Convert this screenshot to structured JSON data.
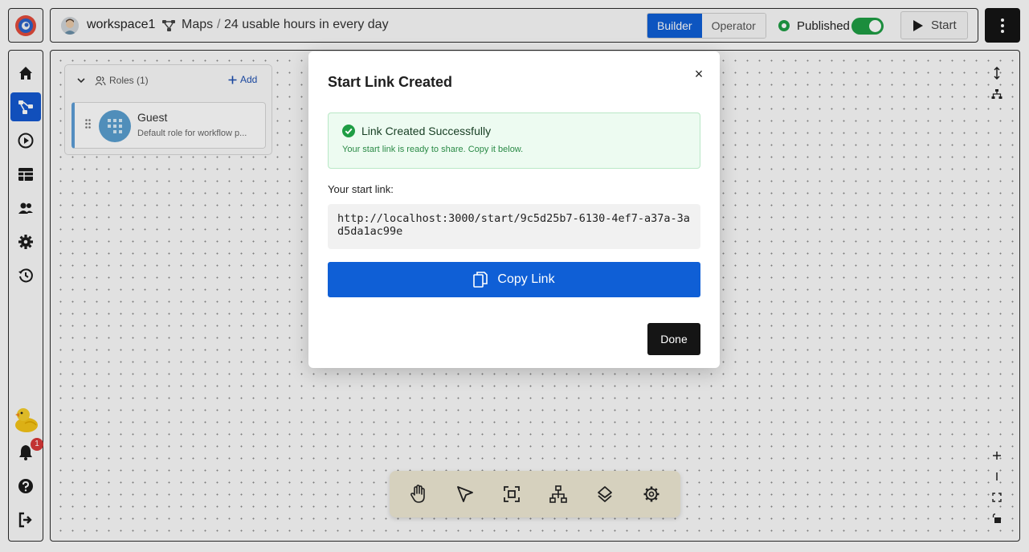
{
  "header": {
    "workspace_name": "workspace1",
    "breadcrumb_section": "Maps",
    "breadcrumb_separator": "/",
    "breadcrumb_title": "24 usable hours in every day",
    "mode_builder": "Builder",
    "mode_operator": "Operator",
    "active_mode": "Builder",
    "status_label": "Published",
    "published_enabled": true,
    "start_label": "Start"
  },
  "sidebar": {
    "items": [
      {
        "icon": "home-icon",
        "active": false
      },
      {
        "icon": "workflow-icon",
        "active": true
      },
      {
        "icon": "play-icon",
        "active": false
      },
      {
        "icon": "table-icon",
        "active": false
      },
      {
        "icon": "users-icon",
        "active": false
      },
      {
        "icon": "gear-icon",
        "active": false
      },
      {
        "icon": "history-icon",
        "active": false
      }
    ],
    "notification_count": "1",
    "bottom_items": [
      "bell-icon",
      "help-icon",
      "logout-icon"
    ]
  },
  "canvas": {
    "roles_panel": {
      "title": "Roles (1)",
      "add_label": "Add",
      "roles": [
        {
          "name": "Guest",
          "description": "Default role for workflow p..."
        }
      ]
    },
    "toolbar": [
      "hand-icon",
      "pointer-icon",
      "fit-view-icon",
      "hierarchy-icon",
      "layers-icon",
      "gear-icon"
    ]
  },
  "modal": {
    "title": "Start Link Created",
    "close_glyph": "×",
    "success_title": "Link Created Successfully",
    "success_message": "Your start link is ready to share. Copy it below.",
    "link_label": "Your start link:",
    "link_value": "http://localhost:3000/start/9c5d25b7-6130-4ef7-a37a-3ad5da1ac99e",
    "copy_label": "Copy Link",
    "done_label": "Done"
  },
  "colors": {
    "primary": "#0f5fd6",
    "success": "#1f9d44",
    "dark": "#151515",
    "badge": "#d93838"
  }
}
